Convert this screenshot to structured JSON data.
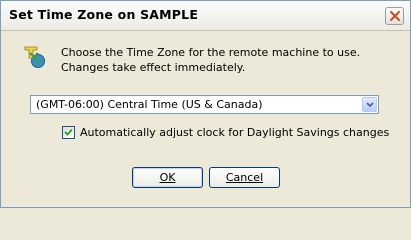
{
  "window": {
    "title": "Set Time Zone on SAMPLE",
    "close_icon": "close-icon"
  },
  "content": {
    "icon": "timezone-globe-icon",
    "message_line1": "Choose the Time Zone for the remote machine to use.",
    "message_line2": "Changes take effect immediately."
  },
  "timezone": {
    "selected": "(GMT-06:00) Central Time (US & Canada)"
  },
  "dst": {
    "checked": true,
    "label": "Automatically adjust clock for Daylight Savings changes"
  },
  "buttons": {
    "ok": "OK",
    "cancel": "Cancel"
  },
  "colors": {
    "dialog_bg": "#ece9d8",
    "button_border": "#003c74",
    "select_border": "#7f9db9",
    "close_x": "#c84f1c"
  }
}
